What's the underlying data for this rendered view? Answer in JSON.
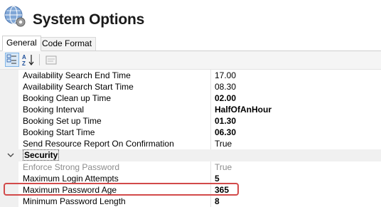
{
  "window": {
    "title": "System Options"
  },
  "tabs": [
    {
      "label": "General",
      "active": true
    },
    {
      "label": "Code Format",
      "active": false
    }
  ],
  "toolbar": {
    "buttons": [
      {
        "icon": "categorized-icon",
        "pressed": true
      },
      {
        "icon": "alphabetical-sort-icon",
        "pressed": false
      },
      {
        "icon": "property-pages-icon",
        "pressed": false,
        "enabled": false
      }
    ]
  },
  "properties": {
    "rows": [
      {
        "name": "Availability Search End Time",
        "value": "17.00"
      },
      {
        "name": "Availability Search Start Time",
        "value": "08.30"
      },
      {
        "name": "Booking Clean up Time",
        "value": "02.00"
      },
      {
        "name": "Booking Interval",
        "value": "HalfOfAnHour"
      },
      {
        "name": "Booking Set up Time",
        "value": "01.30"
      },
      {
        "name": "Booking Start Time",
        "value": "06.30"
      },
      {
        "name": "Send Resource Report On Confirmation",
        "value": "True"
      }
    ],
    "category": {
      "name": "Security",
      "expanded": true
    },
    "security_rows": [
      {
        "name": "Enforce Strong Password",
        "value": "True"
      },
      {
        "name": "Maximum Login Attempts",
        "value": "5"
      },
      {
        "name": "Maximum Password Age",
        "value": "365"
      },
      {
        "name": "Minimum Password Length",
        "value": "8"
      }
    ]
  },
  "colors": {
    "highlight": "#d24a4a",
    "category_bg": "#f0f0f0",
    "selected_button": "#d8e8f7"
  }
}
